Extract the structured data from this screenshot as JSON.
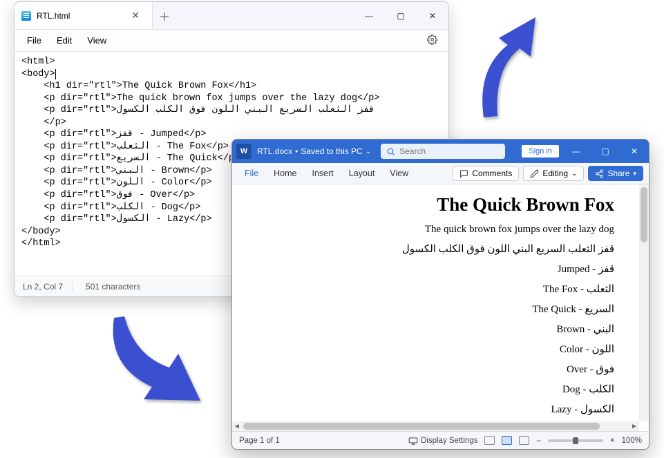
{
  "notepad": {
    "tab_title": "RTL.html",
    "menus": {
      "file": "File",
      "edit": "Edit",
      "view": "View"
    },
    "code_lines": [
      "<html>",
      "<body>",
      "    <h1 dir=\"rtl\">The Quick Brown Fox</h1>",
      "    <p dir=\"rtl\">The quick brown fox jumps over the lazy dog</p>",
      "    <p dir=\"rtl\">قفز الثعلب السريع البني اللون فوق الكلب الكسول",
      "    </p>",
      "    <p dir=\"rtl\">قفز - Jumped</p>",
      "    <p dir=\"rtl\">الثعلب - The Fox</p>",
      "    <p dir=\"rtl\">السريع - The Quick</p>",
      "    <p dir=\"rtl\">البني - Brown</p>",
      "    <p dir=\"rtl\">اللون - Color</p>",
      "    <p dir=\"rtl\">فوق - Over</p>",
      "    <p dir=\"rtl\">الكلب - Dog</p>",
      "    <p dir=\"rtl\">الكسول - Lazy</p>",
      "</body>",
      "</html>"
    ],
    "status": {
      "position": "Ln 2, Col 7",
      "chars": "501 characters"
    }
  },
  "word": {
    "filename": "RTL.docx",
    "saved_label": "Saved to this PC",
    "search_placeholder": "Search",
    "signin": "Sign in",
    "ribbon": {
      "file": "File",
      "home": "Home",
      "insert": "Insert",
      "layout": "Layout",
      "view": "View"
    },
    "comments": "Comments",
    "editing": "Editing",
    "share": "Share",
    "doc": {
      "h1": "The Quick Brown Fox",
      "p1": "The quick brown fox jumps over the lazy dog",
      "p2": "قفز الثعلب السريع البني اللون فوق الكلب الكسول",
      "rows": [
        "قفز - Jumped",
        "الثعلب - The Fox",
        "السريع - The Quick",
        "البني - Brown",
        "اللون - Color",
        "فوق - Over",
        "الكلب - Dog",
        "الكسول - Lazy"
      ]
    },
    "status": {
      "page": "Page 1 of 1",
      "display": "Display Settings",
      "zoom": "100%"
    }
  },
  "colors": {
    "arrow": "#3b4fd1",
    "word_accent": "#2f6bd1"
  }
}
